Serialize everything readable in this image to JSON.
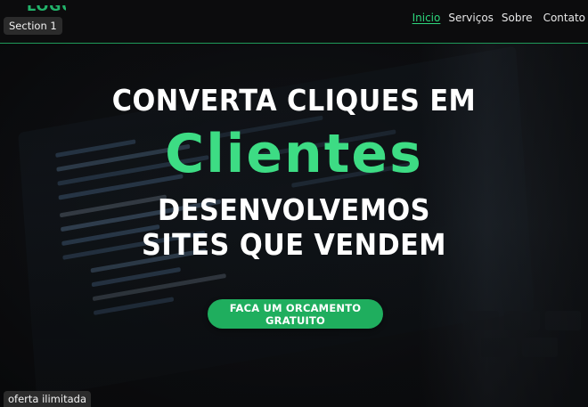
{
  "header": {
    "logo_text": "LOGO",
    "nav": [
      {
        "label": "Inicio",
        "active": true
      },
      {
        "label": "Serviços",
        "active": false
      },
      {
        "label": "Sobre",
        "active": false
      },
      {
        "label": "Contato",
        "active": false
      }
    ]
  },
  "section_label": "Section 1",
  "hero": {
    "line1": "CONVERTA CLIQUES EM",
    "accent": "Clientes",
    "line3": "DESENVOLVEMOS",
    "line4": "SITES QUE VENDEM",
    "cta_label": "FACA UM ORCAMENTO GRATUITO"
  },
  "offer_label": "oferta ilimitada",
  "colors": {
    "accent": "#3ddc84",
    "cta": "#1fae5e",
    "header_border": "#1f9a5a",
    "background": "#0b0b0c"
  }
}
